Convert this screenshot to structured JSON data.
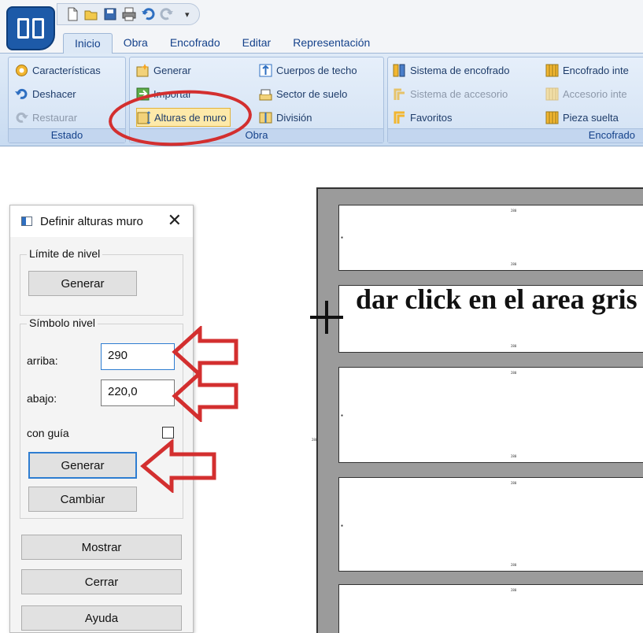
{
  "ribbon": {
    "tabs": [
      "Inicio",
      "Obra",
      "Encofrado",
      "Editar",
      "Representación"
    ],
    "active_tab": "Inicio",
    "groups": {
      "estado": {
        "label": "Estado",
        "items": [
          "Características",
          "Deshacer",
          "Restaurar"
        ]
      },
      "obra": {
        "label": "Obra",
        "items": [
          "Generar",
          "Importar",
          "Alturas de muro",
          "Cuerpos de techo",
          "Sector de suelo",
          "División"
        ]
      },
      "encofrado": {
        "label": "Encofrado",
        "items": [
          "Sistema de encofrado",
          "Sistema de accesorio",
          "Favoritos",
          "Encofrado inte",
          "Accesorio inte",
          "Pieza suelta"
        ]
      }
    }
  },
  "dialog": {
    "title": "Definir alturas muro",
    "limite_group": {
      "legend": "Límite de nivel",
      "generate_button": "Generar"
    },
    "simbolo_group": {
      "legend": "Símbolo nivel",
      "arriba_label": "arriba:",
      "arriba_value": "290",
      "abajo_label": "abajo:",
      "abajo_value": "220,0",
      "guide_label": "con guía",
      "guide_checked": false,
      "generate_button": "Generar",
      "change_button": "Cambiar"
    },
    "show_button": "Mostrar",
    "close_button": "Cerrar",
    "help_button": "Ayuda"
  },
  "annotation": {
    "text": "dar click en el area gris",
    "highlight_color": "#d32f2f"
  },
  "drawing": {
    "tick_labels": [
      "280",
      "280",
      "280",
      "280",
      "280",
      "280",
      "280",
      "280",
      "280"
    ]
  },
  "colors": {
    "app_blue": "#1d5aa8",
    "ribbon_text": "#15428b",
    "arrow_red": "#d32f2f",
    "sheet_gray": "#9b9b9b"
  }
}
